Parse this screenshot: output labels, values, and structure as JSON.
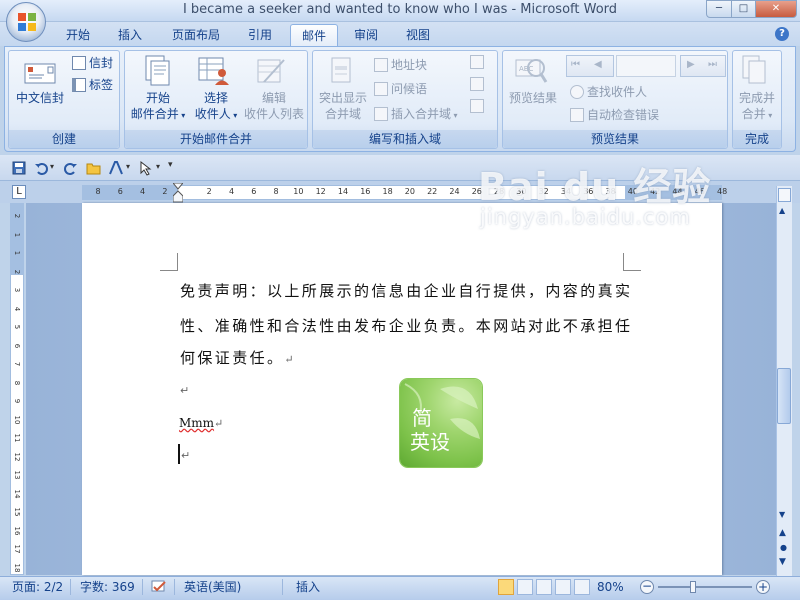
{
  "window": {
    "title": "I became a seeker and wanted to know who I was - Microsoft Word",
    "minimize": "─",
    "maximize": "□",
    "close": "✕"
  },
  "tabs": [
    "开始",
    "插入",
    "页面布局",
    "引用",
    "邮件",
    "审阅",
    "视图"
  ],
  "active_tab": "邮件",
  "help_label": "?",
  "ribbon": {
    "create": {
      "label": "创建",
      "envelope": "中文信封",
      "envelopes": "信封",
      "labels": "标签"
    },
    "start_merge": {
      "label": "开始邮件合并",
      "start_line1": "开始",
      "start_line2": "邮件合并",
      "select_line1": "选择",
      "select_line2": "收件人",
      "edit_line1": "编辑",
      "edit_line2": "收件人列表"
    },
    "write_insert": {
      "label": "编写和插入域",
      "highlight_line1": "突出显示",
      "highlight_line2": "合并域",
      "address_block": "地址块",
      "greeting_line": "问候语",
      "insert_merge_field": "插入合并域"
    },
    "preview": {
      "label": "预览结果",
      "preview_results": "预览结果",
      "find_recipient": "查找收件人",
      "auto_check": "自动检查错误"
    },
    "finish": {
      "label": "完成",
      "finish_line1": "完成并",
      "finish_line2": "合并"
    }
  },
  "ruler": {
    "corner": "L",
    "numbers": [
      "8",
      "6",
      "4",
      "2",
      "2",
      "4",
      "6",
      "8",
      "10",
      "12",
      "14",
      "16",
      "18",
      "20",
      "22",
      "24",
      "26",
      "28",
      "30",
      "32",
      "34",
      "36",
      "38",
      "40",
      "42",
      "44",
      "46",
      "48"
    ],
    "vnumbers": [
      "2",
      "1",
      "1",
      "2",
      "3",
      "4",
      "5",
      "6",
      "7",
      "8",
      "9",
      "10",
      "11",
      "12",
      "13",
      "14",
      "15",
      "16",
      "17",
      "18"
    ]
  },
  "document": {
    "line1": "免责声明：以上所展示的信息由企业自行提供，内容的真实",
    "line2": "性、准确性和合法性由发布企业负责。本网站对此不承担任",
    "line3": "何保证责任。",
    "return_mark": "↵",
    "line5": "Mmm",
    "cursor_line": "|"
  },
  "stamp": {
    "line1": "简",
    "line2": "英设"
  },
  "watermark": {
    "brand": "Bai du 经验",
    "url": "jingyan.baidu.com"
  },
  "status": {
    "page": "页面: 2/2",
    "words": "字数: 369",
    "language": "英语(美国)",
    "mode": "插入",
    "zoom": "80%",
    "zoom_minus": "−",
    "zoom_plus": "+"
  },
  "colors": {
    "ribbon_text": "#15428b",
    "stamp_green": "#7dc24a"
  }
}
